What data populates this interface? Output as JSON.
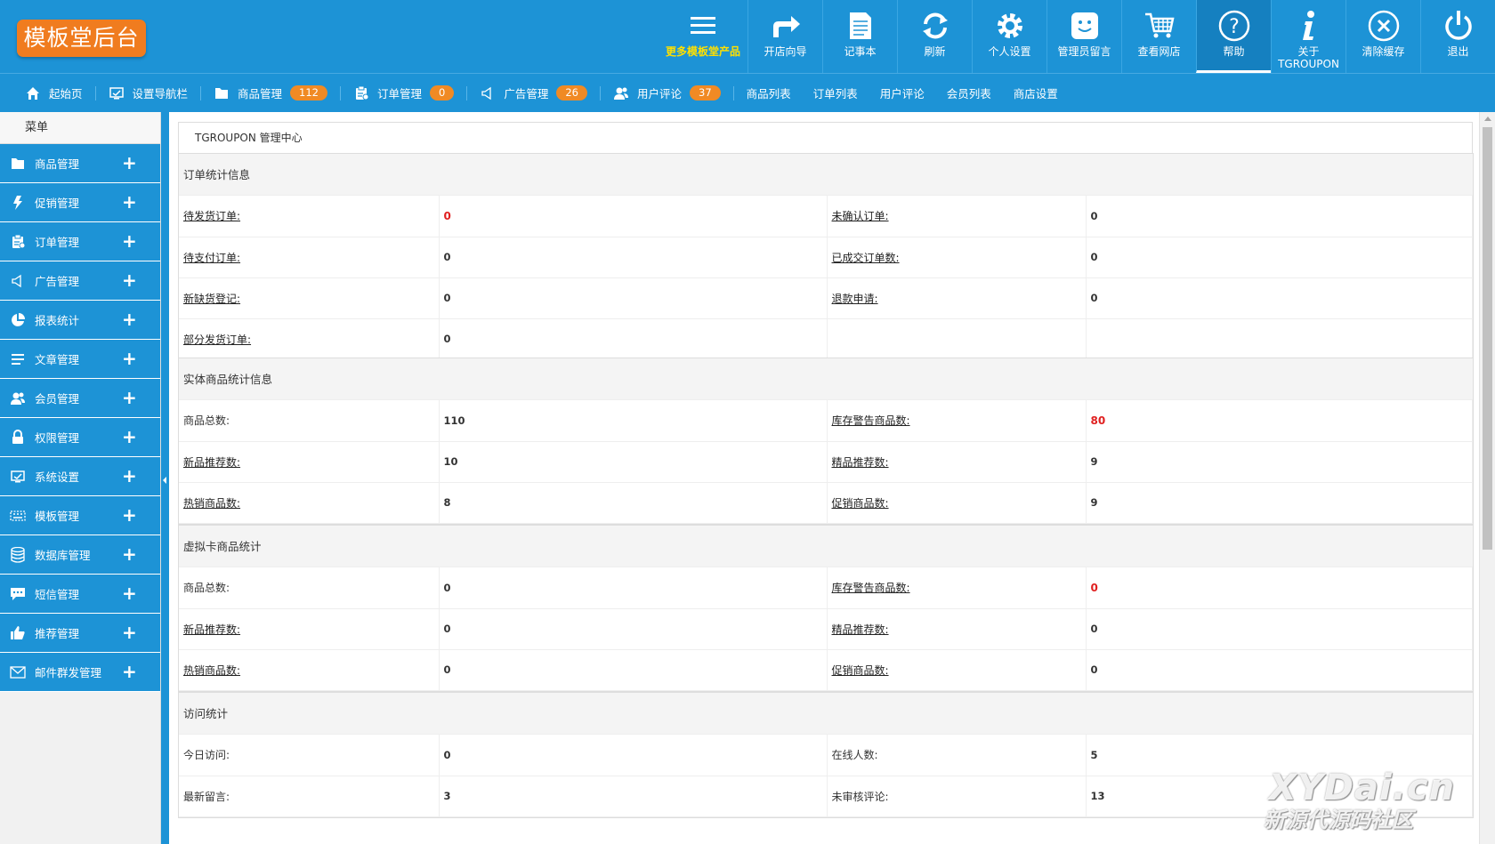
{
  "app": {
    "logo_text": "模板堂后台"
  },
  "toolbar": [
    {
      "label": "更多模板堂产品",
      "icon": "menu-icon"
    },
    {
      "label": "开店向导",
      "icon": "share-arrow-icon"
    },
    {
      "label": "记事本",
      "icon": "notepad-icon"
    },
    {
      "label": "刷新",
      "icon": "refresh-icon"
    },
    {
      "label": "个人设置",
      "icon": "gear-icon"
    },
    {
      "label": "管理员留言",
      "icon": "message-icon"
    },
    {
      "label": "查看网店",
      "icon": "cart-icon"
    },
    {
      "label": "帮助",
      "icon": "help-icon",
      "active": true
    },
    {
      "label": "关于",
      "label2": "TGROUPON",
      "icon": "info-icon"
    },
    {
      "label": "清除缓存",
      "icon": "close-circle-icon"
    },
    {
      "label": "退出",
      "icon": "power-icon"
    }
  ],
  "nav": [
    {
      "label": "起始页",
      "icon": "home-icon"
    },
    {
      "label": "设置导航栏",
      "icon": "monitor-icon"
    },
    {
      "label": "商品管理",
      "icon": "folder-icon",
      "badge": "112"
    },
    {
      "label": "订单管理",
      "icon": "clipboard-icon",
      "badge": "0"
    },
    {
      "label": "广告管理",
      "icon": "speaker-icon",
      "badge": "26"
    },
    {
      "label": "用户评论",
      "icon": "users-icon",
      "badge": "37"
    },
    {
      "label": "商品列表"
    },
    {
      "label": "订单列表"
    },
    {
      "label": "用户评论"
    },
    {
      "label": "会员列表"
    },
    {
      "label": "商店设置"
    }
  ],
  "sidebar": {
    "title": "菜单",
    "items": [
      {
        "label": "商品管理",
        "icon": "folder-icon"
      },
      {
        "label": "促销管理",
        "icon": "lightning-icon"
      },
      {
        "label": "订单管理",
        "icon": "clipboard-icon"
      },
      {
        "label": "广告管理",
        "icon": "speaker-icon"
      },
      {
        "label": "报表统计",
        "icon": "pie-chart-icon"
      },
      {
        "label": "文章管理",
        "icon": "list-icon"
      },
      {
        "label": "会员管理",
        "icon": "users-icon"
      },
      {
        "label": "权限管理",
        "icon": "lock-icon"
      },
      {
        "label": "系统设置",
        "icon": "monitor-icon"
      },
      {
        "label": "模板管理",
        "icon": "keyboard-icon"
      },
      {
        "label": "数据库管理",
        "icon": "database-icon"
      },
      {
        "label": "短信管理",
        "icon": "chat-icon"
      },
      {
        "label": "推荐管理",
        "icon": "thumbs-up-icon"
      },
      {
        "label": "邮件群发管理",
        "icon": "mail-icon"
      }
    ],
    "expand_symbol": "+"
  },
  "main": {
    "breadcrumb": "TGROUPON 管理中心",
    "panels": [
      {
        "title": "订单统计信息",
        "rows": [
          {
            "l1": "待发货订单:",
            "v1": "0",
            "v1_red": true,
            "l2": "未确认订单:",
            "v2": "0",
            "link1": true,
            "link2": true
          },
          {
            "l1": "待支付订单:",
            "v1": "0",
            "l2": "已成交订单数:",
            "v2": "0",
            "link1": true,
            "link2": true
          },
          {
            "l1": "新缺货登记:",
            "v1": "0",
            "l2": "退款申请:",
            "v2": "0",
            "link1": true,
            "link2": true
          },
          {
            "l1": "部分发货订单:",
            "v1": "0",
            "l2": "",
            "v2": "",
            "link1": true
          }
        ]
      },
      {
        "title": "实体商品统计信息",
        "rows": [
          {
            "l1": "商品总数:",
            "v1": "110",
            "l2": "库存警告商品数:",
            "v2": "80",
            "v2_red": true,
            "link2": true
          },
          {
            "l1": "新品推荐数:",
            "v1": "10",
            "l2": "精品推荐数:",
            "v2": "9",
            "link1": true,
            "link2": true
          },
          {
            "l1": "热销商品数:",
            "v1": "8",
            "l2": "促销商品数:",
            "v2": "9",
            "link1": true,
            "link2": true
          }
        ]
      },
      {
        "title": "虚拟卡商品统计",
        "rows": [
          {
            "l1": "商品总数:",
            "v1": "0",
            "l2": "库存警告商品数:",
            "v2": "0",
            "v2_red": true,
            "link2": true
          },
          {
            "l1": "新品推荐数:",
            "v1": "0",
            "l2": "精品推荐数:",
            "v2": "0",
            "link1": true,
            "link2": true
          },
          {
            "l1": "热销商品数:",
            "v1": "0",
            "l2": "促销商品数:",
            "v2": "0",
            "link1": true,
            "link2": true
          }
        ]
      },
      {
        "title": "访问统计",
        "rows": [
          {
            "l1": "今日访问:",
            "v1": "0",
            "l2": "在线人数:",
            "v2": "5"
          },
          {
            "l1": "最新留言:",
            "v1": "3",
            "l2": "未审核评论:",
            "v2": "13"
          }
        ]
      }
    ]
  },
  "watermark": {
    "line1": "XYDai.cn",
    "line2": "新源代源码社区"
  }
}
